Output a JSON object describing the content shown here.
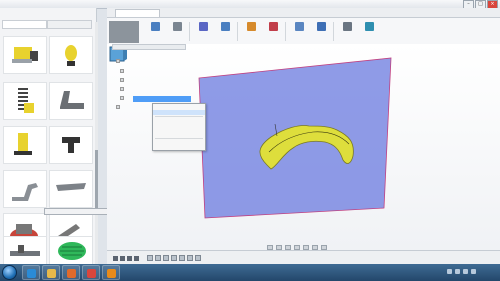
{
  "window": {
    "title": "",
    "controls": [
      "minimize",
      "maximize",
      "close"
    ]
  },
  "left_panel": {
    "header": "",
    "tabs": [
      "",
      ""
    ],
    "tooltip": "",
    "tiles": [
      {
        "icon": "yellow-cube-part-icon"
      },
      {
        "icon": "yellow-spring-gear-icon"
      },
      {
        "icon": "spring-coil-icon"
      },
      {
        "icon": "bracket-arm-icon"
      },
      {
        "icon": "yellow-bracket-icon"
      },
      {
        "icon": "black-clamp-icon"
      },
      {
        "icon": "gray-hook-icon"
      },
      {
        "icon": "gray-blade-icon"
      },
      {
        "icon": "red-robot-base-icon"
      },
      {
        "icon": "gray-arm-icon"
      },
      {
        "icon": "gray-rail-icon"
      },
      {
        "icon": "green-gripper-icon"
      }
    ]
  },
  "app": {
    "document_tab": "",
    "workspace": ""
  },
  "toolbar": {
    "tools": [
      {
        "icon": "sketch-icon",
        "color": "#4a7fc1"
      },
      {
        "icon": "create-icon",
        "color": "#7a8591"
      },
      {
        "icon": "modify-icon",
        "color": "#5a66c4"
      },
      {
        "icon": "assemble-icon",
        "color": "#4a7fc1"
      },
      {
        "icon": "construct-icon",
        "color": "#d68a2c"
      },
      {
        "icon": "inspect-icon",
        "color": "#c13e4a"
      },
      {
        "icon": "insert-icon",
        "color": "#5a86c1"
      },
      {
        "icon": "make-icon",
        "color": "#3e6fb5"
      },
      {
        "icon": "addins-icon",
        "color": "#6a7582"
      },
      {
        "icon": "select-icon",
        "color": "#2f8fb0"
      }
    ]
  },
  "browser": {
    "header": "",
    "rows": [
      "",
      "",
      "",
      "",
      "",
      ""
    ],
    "selected_row": ""
  },
  "context_menu": {
    "items": [
      "",
      "",
      "",
      "",
      "",
      "",
      "",
      "",
      ""
    ],
    "highlighted_index": 1
  },
  "timeline": {
    "coords": ""
  },
  "taskbar": {
    "apps": [
      {
        "icon": "ie-icon",
        "color": "#2a8bd6"
      },
      {
        "icon": "explorer-icon",
        "color": "#e6b84a"
      },
      {
        "icon": "media-icon",
        "color": "#e06a2b"
      },
      {
        "icon": "chrome-icon",
        "color": "#d9463c"
      },
      {
        "icon": "fusion-icon",
        "color": "#e88a1a"
      }
    ],
    "clock": ""
  },
  "colors": {
    "sketch_plane": "#6f7fe0",
    "body": "#e8e85a",
    "selection": "#4f9df7"
  }
}
